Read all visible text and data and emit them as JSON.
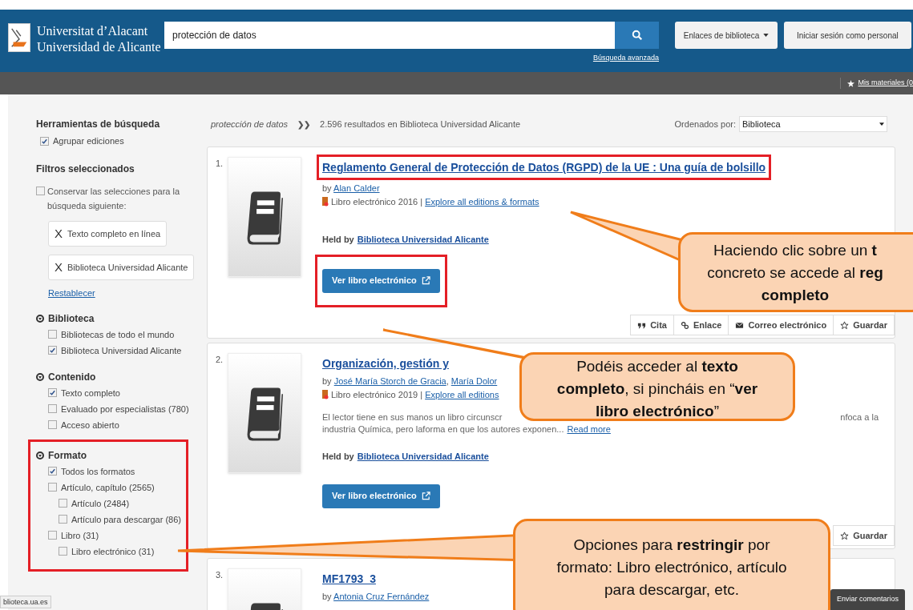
{
  "header": {
    "logo_line1": "Universitat d’Alacant",
    "logo_line2": "Universidad de Alicante",
    "search": {
      "value": "protección de datos"
    },
    "advanced_search": "Búsqueda avanzada",
    "library_links": "Enlaces de biblioteca",
    "login": "Iniciar sesión como personal"
  },
  "toolbar": {
    "my_materials": "Mis materiales (0"
  },
  "sidebar": {
    "tools": {
      "title": "Herramientas de búsqueda",
      "options": [
        {
          "label": "Agrupar ediciones",
          "checked": true
        }
      ]
    },
    "selected_filters": {
      "title": "Filtros seleccionados",
      "keep": {
        "label": "Conservar las selecciones para la búsqueda siguiente:",
        "checked": false
      },
      "chips": [
        {
          "remove": "X",
          "label": "Texto completo en línea"
        },
        {
          "remove": "X",
          "label": "Biblioteca Universidad Alicante"
        }
      ],
      "reset": "Restablecer"
    },
    "facets": [
      {
        "title": "Biblioteca",
        "highlighted": false,
        "options": [
          {
            "label": "Bibliotecas de todo el mundo",
            "checked": false
          },
          {
            "label": "Biblioteca Universidad Alicante",
            "checked": true
          }
        ]
      },
      {
        "title": "Contenido",
        "highlighted": false,
        "options": [
          {
            "label": "Texto completo",
            "checked": true
          },
          {
            "label": "Evaluado por especialistas (780)",
            "checked": false
          },
          {
            "label": "Acceso abierto",
            "checked": false
          }
        ]
      },
      {
        "title": "Formato",
        "highlighted": true,
        "options": [
          {
            "label": "Todos los formatos",
            "checked": true
          },
          {
            "label": "Artículo, capítulo (2565)",
            "checked": false,
            "children": [
              {
                "label": "Artículo (2484)",
                "checked": false
              },
              {
                "label": "Artículo para descargar (86)",
                "checked": false
              }
            ]
          },
          {
            "label": "Libro (31)",
            "checked": false,
            "children": [
              {
                "label": "Libro electrónico (31)",
                "checked": false
              }
            ]
          }
        ]
      }
    ]
  },
  "results_header": {
    "query": "protección de datos",
    "separator": "❯❯",
    "count": "2.596 resultados en Biblioteca Universidad Alicante",
    "sort_label": "Ordenados por:",
    "sort_value": "Biblioteca"
  },
  "results": [
    {
      "number": "1.",
      "title": "Reglamento General de Protección de Datos (RGPD) de la UE : Una guía de bolsillo",
      "title_highlighted": true,
      "by": "by",
      "authors": [
        "Alan Calder"
      ],
      "format": "Libro electrónico 2016 |",
      "editions_link": "Explore all editions & formats",
      "held_by_label": "Held by",
      "held_by": "Biblioteca Universidad Alicante",
      "button": "Ver libro electrónico",
      "button_highlighted": true,
      "actions": [
        "Cita",
        "Enlace",
        "Correo electrónico",
        "Guardar"
      ]
    },
    {
      "number": "2.",
      "title": "Organización, gestión y",
      "title_highlighted": false,
      "by": "by",
      "authors": [
        "José María Storch de Gracia",
        "María Dolor"
      ],
      "author_separator": ",",
      "format": "Libro electrónico 2019 |",
      "editions_link": "Explore all editions",
      "description_start": "El lector tiene en sus manos un libro circunscr",
      "description_end": "nfoca a la",
      "description_line2": "industria Química, pero laforma en que los autores exponen...",
      "read_more": "Read more",
      "held_by_label": "Held by",
      "held_by": "Biblioteca Universidad Alicante",
      "button": "Ver libro electrónico",
      "button_highlighted": false,
      "actions": [
        "Guardar"
      ]
    },
    {
      "number": "3.",
      "title": "MF1793_3",
      "title_highlighted": false,
      "by": "by",
      "authors": [
        "Antonia Cruz Fernández"
      ]
    }
  ],
  "callouts": [
    {
      "lines": [
        "Haciendo clic sobre un **t**",
        "concreto se accede al **reg**",
        "**completo**"
      ]
    },
    {
      "lines": [
        "Podéis acceder al **texto**",
        "**completo**, si pincháis en “**ver**",
        "**libro electrónico**”"
      ]
    },
    {
      "lines": [
        "Opciones para **restringir** por",
        "formato: Libro electrónico, artículo",
        "para descargar, etc."
      ]
    }
  ],
  "status_url": "blioteca.ua.es",
  "feedback": "Enviar comentarios"
}
